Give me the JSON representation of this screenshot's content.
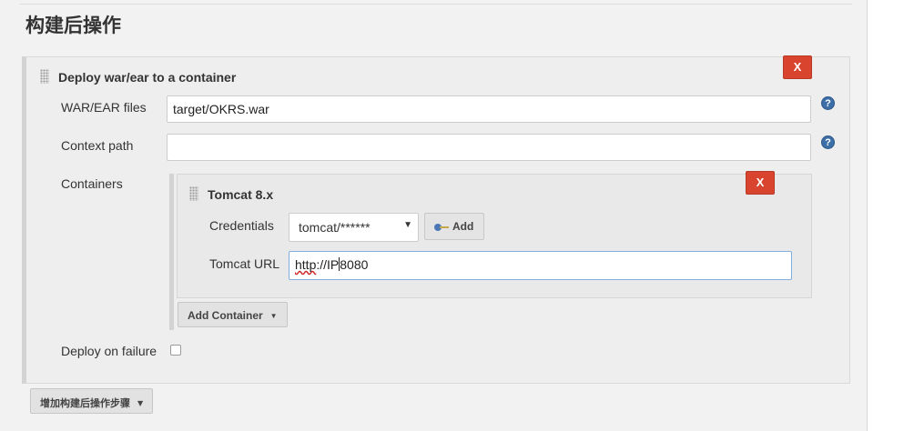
{
  "section": {
    "title": "构建后操作"
  },
  "deploy_step": {
    "title": "Deploy war/ear to a container",
    "delete_label": "X",
    "fields": {
      "war_files": {
        "label": "WAR/EAR files",
        "value": "target/OKRS.war",
        "help": "?"
      },
      "context_path": {
        "label": "Context path",
        "value": "",
        "help": "?"
      },
      "containers": {
        "label": "Containers"
      },
      "deploy_on_failure": {
        "label": "Deploy on failure",
        "checked": false
      }
    },
    "container": {
      "title": "Tomcat 8.x",
      "delete_label": "X",
      "credentials_label": "Credentials",
      "credentials_selected": "tomcat/******",
      "credentials_add": "Add",
      "url_label": "Tomcat URL",
      "url_value_underlined": "http",
      "url_value_mid": "://IP",
      "url_value_rest": "8080"
    },
    "add_container_label": "Add Container"
  },
  "add_post_build_label": "增加构建后操作步骤"
}
